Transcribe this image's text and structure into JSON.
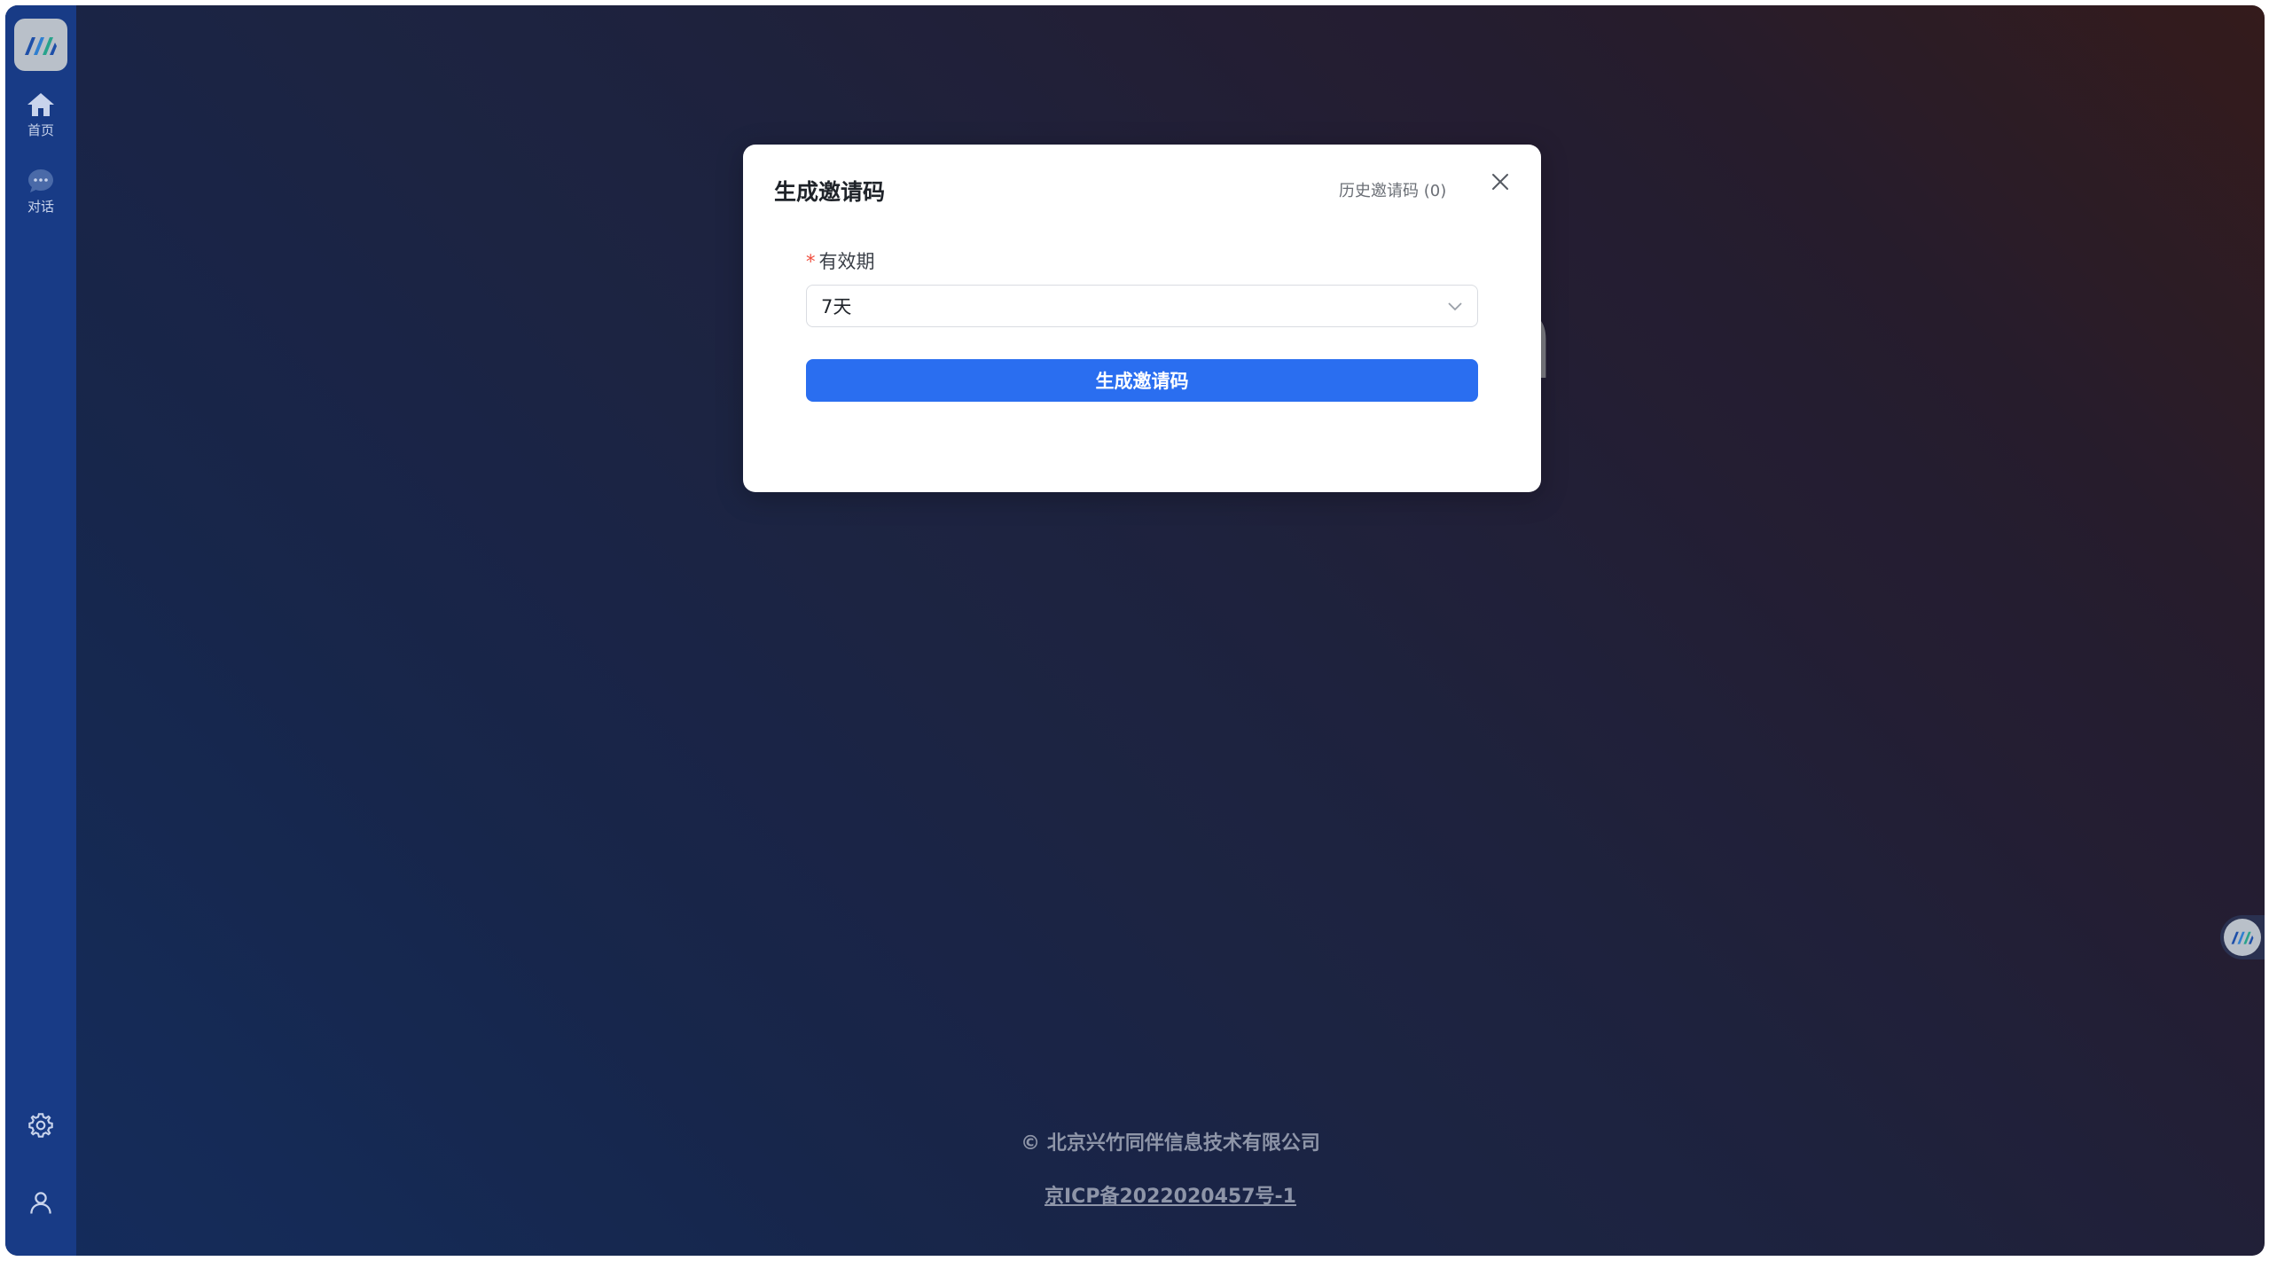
{
  "sidebar": {
    "logo_icon": "brand-logo-icon",
    "items": [
      {
        "label": "首页",
        "icon": "home-icon"
      },
      {
        "label": "对话",
        "icon": "chat-bubble-icon"
      }
    ],
    "bottom": [
      {
        "icon": "gear-icon"
      },
      {
        "icon": "user-icon"
      }
    ]
  },
  "background": {
    "partial_text": "n"
  },
  "modal": {
    "title": "生成邀请码",
    "history_link": "历史邀请码 (0)",
    "field_label": "有效期",
    "required_mark": "*",
    "select_value": "7天",
    "submit_label": "生成邀请码"
  },
  "footer": {
    "copyright": "© 北京兴竹同伴信息技术有限公司",
    "icp": "京ICP备2022020457号-1"
  },
  "colors": {
    "primary": "#2a6ef0",
    "sidebar": "#183b86",
    "required": "#f04e3e"
  }
}
